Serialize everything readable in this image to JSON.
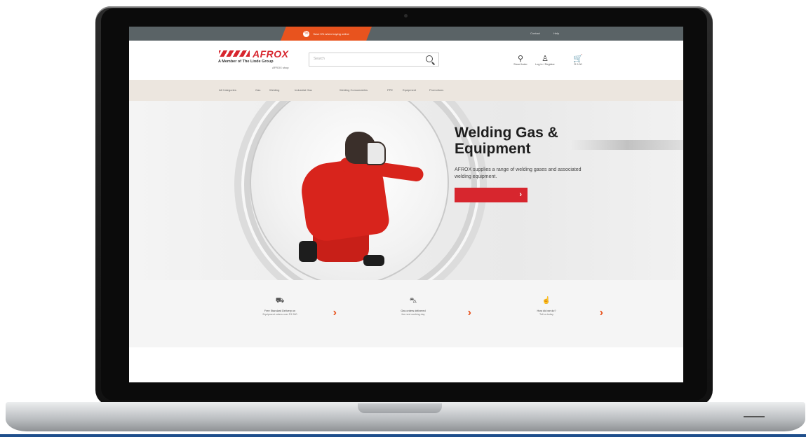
{
  "topbar": {
    "promo_text": "Save 5% when buying online",
    "links": [
      "Contact",
      "Help"
    ]
  },
  "header": {
    "logo_name": "AFROX",
    "logo_tagline": "A Member of The Linde Group",
    "logo_sub": "AFROX shop",
    "search_placeholder": "Search",
    "icons": [
      {
        "name": "location-icon",
        "glyph": "⚲",
        "label": "Store finder"
      },
      {
        "name": "user-icon",
        "glyph": "♙",
        "label": "Log in / Register"
      },
      {
        "name": "cart-icon",
        "glyph": "🛒",
        "label": "R 0.00"
      }
    ]
  },
  "nav": {
    "items": [
      "All Categories",
      "Gas",
      "Welding",
      "Industrial Gas",
      "Welding Consumables",
      "PPE",
      "Equipment",
      "Promotions"
    ]
  },
  "hero": {
    "title": "Welding Gas &\nEquipment",
    "description": "AFROX supplies a range of welding gases and associated welding equipment.",
    "button_chevron": "›"
  },
  "features": [
    {
      "icon": "truck-icon",
      "glyph": "⛟",
      "title": "Free Standard Delivery on",
      "sub": "Equipment orders over R1 500"
    },
    {
      "icon": "van-icon",
      "glyph": "⛍",
      "title": "Gas orders delivered",
      "sub": "the next working day"
    },
    {
      "icon": "touch-icon",
      "glyph": "☝",
      "title": "How did we do?",
      "sub": "Tell us today"
    }
  ],
  "colors": {
    "brand_red": "#d7262e",
    "promo_orange": "#e8531e",
    "topbar": "#5a6366",
    "nav_bg": "#ece6df"
  }
}
